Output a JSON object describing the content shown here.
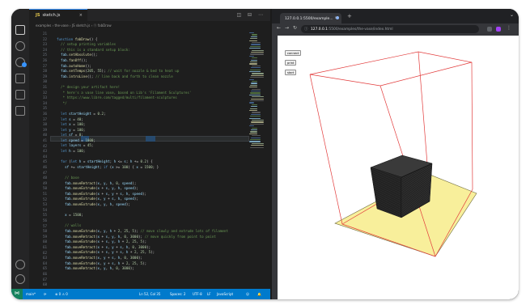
{
  "vscode": {
    "tab": {
      "icon": "JS",
      "label": "sketch.js",
      "close": "×"
    },
    "tab_tools": "◫ ⊟ ⋯",
    "breadcrumb": "examples › the-vase › JS sketch.js › ⓕ fabDraw",
    "activity_icons": [
      "files-icon",
      "search-icon",
      "source-control-icon",
      "run-debug-icon",
      "extensions-icon",
      "test-icon"
    ],
    "line_numbers": [
      "21",
      "22",
      "23",
      "24",
      "25",
      "26",
      "27",
      "28",
      "29",
      "30",
      "31",
      "32",
      "33",
      "34",
      "35",
      "36",
      "37",
      "38",
      "39",
      "40",
      "41",
      "42",
      "43",
      "44",
      "45",
      "46",
      "47",
      "48",
      "49",
      "50",
      "51",
      "52",
      "53",
      "54",
      "55",
      "56",
      "57",
      "58",
      "59",
      "60",
      "61",
      "62",
      "63",
      "64",
      "65",
      "66",
      "67",
      "68"
    ],
    "status": {
      "branch": "main*",
      "sync": "⟳",
      "problems": "⊗ 0 ⚠ 0",
      "position": "Ln 52, Col 35",
      "spaces": "Spaces: 2",
      "encoding": "UTF-8",
      "eol": "LF",
      "language": "JavaScript",
      "feedback": "☺",
      "bell": "🔔"
    }
  },
  "browser": {
    "tab": {
      "label": "127.0.0.1:5500/example...",
      "close": "×"
    },
    "new_tab": "+",
    "url_host": "127.0.0.1",
    "url_path": ":5500/examples/the-vase/index.html",
    "buttons": [
      "connect",
      "print",
      "start"
    ],
    "colors": {
      "box_edge": "#e23b3b",
      "bed": "#f8ef9b",
      "bed_edge": "#6e6a3c",
      "cube_face": "#2b2b2b",
      "layer_line": "#111111"
    }
  }
}
